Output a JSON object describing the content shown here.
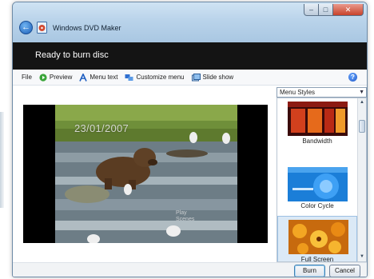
{
  "window": {
    "title": "Windows DVD Maker",
    "status": "Ready to burn disc"
  },
  "toolbar": {
    "file_label": "File",
    "preview_label": "Preview",
    "menu_text_label": "Menu text",
    "customize_menu_label": "Customize menu",
    "slide_show_label": "Slide show"
  },
  "preview": {
    "date_overlay": "23/01/2007",
    "play_overlay_line1": "Play",
    "play_overlay_line2": "Scenes"
  },
  "menu_styles": {
    "dropdown_label": "Menu Styles",
    "items": [
      {
        "label": "Bandwidth",
        "selected": false
      },
      {
        "label": "Color Cycle",
        "selected": false
      },
      {
        "label": "Full Screen",
        "selected": true
      }
    ]
  },
  "footer": {
    "burn_label": "Burn",
    "cancel_label": "Cancel"
  },
  "colors": {
    "status_bar": "#141414",
    "selection": "#dbe9f6",
    "titlebar": "#b9d3ea"
  }
}
